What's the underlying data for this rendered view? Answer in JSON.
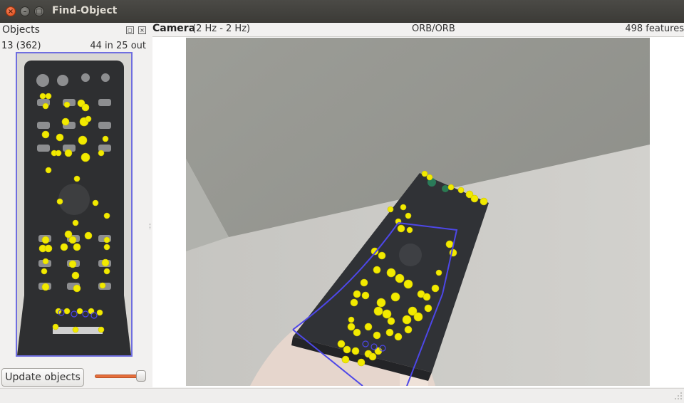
{
  "window": {
    "title": "Find-Object",
    "close_glyph": "×",
    "minimize_glyph": "–",
    "maximize_glyph": "▢"
  },
  "objects_panel": {
    "title": "Objects",
    "float_glyph": "◻",
    "close_glyph": "×",
    "object_id": "13 (362)",
    "inliers_outliers": "44 in 25 out",
    "update_button": "Update objects",
    "slider_level": 0.9
  },
  "camera_panel": {
    "title": "Camera",
    "rate": "(2 Hz - 2 Hz)",
    "algorithm": "ORB/ORB",
    "features": "498 features"
  },
  "colors": {
    "keypoint": "#f2ea00",
    "inlier_outline": "#4d47e8",
    "slider": "#e66f3c"
  }
}
